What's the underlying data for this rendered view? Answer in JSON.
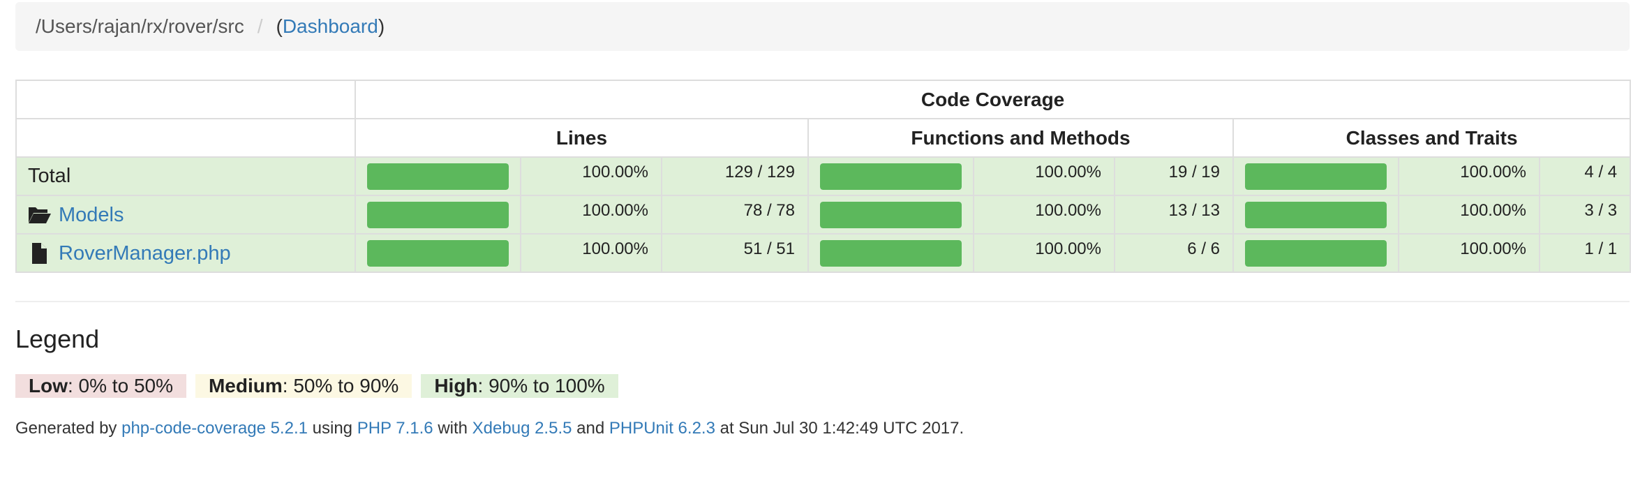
{
  "breadcrumb": {
    "path": "/Users/rajan/rx/rover/src",
    "separator": "/",
    "open_paren": "(",
    "dashboard_link": "Dashboard",
    "close_paren": ")"
  },
  "table": {
    "header_top": "Code Coverage",
    "group_headers": [
      "Lines",
      "Functions and Methods",
      "Classes and Traits"
    ],
    "rows": [
      {
        "name": "Total",
        "icon": "",
        "lines": {
          "percent": "100.00%",
          "count": "129 / 129",
          "fill": 1.0
        },
        "functions": {
          "percent": "100.00%",
          "count": "19 / 19",
          "fill": 1.0
        },
        "classes": {
          "percent": "100.00%",
          "count": "4 / 4",
          "fill": 1.0
        }
      },
      {
        "name": "Models",
        "icon": "folder-open-icon",
        "lines": {
          "percent": "100.00%",
          "count": "78 / 78",
          "fill": 1.0
        },
        "functions": {
          "percent": "100.00%",
          "count": "13 / 13",
          "fill": 1.0
        },
        "classes": {
          "percent": "100.00%",
          "count": "3 / 3",
          "fill": 1.0
        }
      },
      {
        "name": "RoverManager.php",
        "icon": "file-icon",
        "lines": {
          "percent": "100.00%",
          "count": "51 / 51",
          "fill": 1.0
        },
        "functions": {
          "percent": "100.00%",
          "count": "6 / 6",
          "fill": 1.0
        },
        "classes": {
          "percent": "100.00%",
          "count": "1 / 1",
          "fill": 1.0
        }
      }
    ]
  },
  "legend": {
    "title": "Legend",
    "low": {
      "label": "Low",
      "range": ": 0% to 50%"
    },
    "medium": {
      "label": "Medium",
      "range": ": 50% to 90%"
    },
    "high": {
      "label": "High",
      "range": ": 90% to 100%"
    }
  },
  "footer": {
    "prefix": "Generated by ",
    "tool_link": "php-code-coverage 5.2.1",
    "using": " using ",
    "php_link": "PHP 7.1.6",
    "with": " with ",
    "xdebug_link": "Xdebug 2.5.5",
    "and": " and ",
    "phpunit_link": "PHPUnit 6.2.3",
    "suffix": " at Sun Jul 30 1:42:49 UTC 2017."
  },
  "colors": {
    "success": "#5cb85c",
    "row_success_bg": "#dff0d8",
    "link": "#337ab7",
    "low_bg": "#f2dede",
    "medium_bg": "#fcf8e3"
  }
}
